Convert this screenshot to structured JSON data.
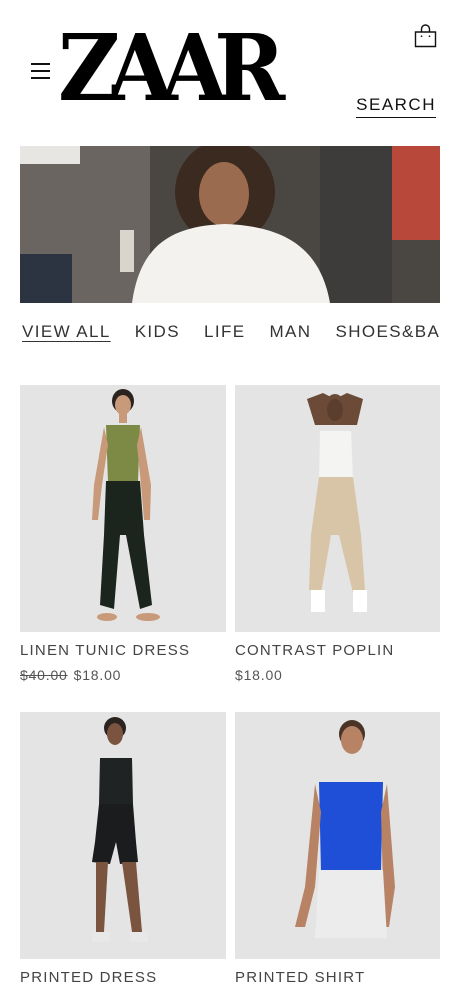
{
  "header": {
    "logo_text": "ZAAR",
    "search_label": "SEARCH",
    "menu_icon": "hamburger-menu-icon",
    "bag_icon": "shopping-bag-icon"
  },
  "hero": {
    "image": "woman-in-white-tee-photo"
  },
  "tabs": [
    {
      "label": "VIEW ALL",
      "active": true
    },
    {
      "label": "KIDS",
      "active": false
    },
    {
      "label": "LIFE",
      "active": false
    },
    {
      "label": "MAN",
      "active": false
    },
    {
      "label": "SHOES&BAGS",
      "active": false
    }
  ],
  "products": [
    {
      "name": "LINEN TUNIC DRESS",
      "old_price": "$40.00",
      "price": "$18.00",
      "image": "model-green-tank-black-leggings"
    },
    {
      "name": "CONTRAST POPLIN",
      "old_price": "",
      "price": "$18.00",
      "image": "model-white-top-beige-joggers"
    },
    {
      "name": "PRINTED DRESS",
      "old_price": "",
      "price": "",
      "image": "model-black-crop-bike-shorts"
    },
    {
      "name": "PRINTED SHIRT",
      "old_price": "",
      "price": "",
      "image": "model-blue-tank-white-shorts"
    }
  ],
  "colors": {
    "text": "#333333",
    "image_bg": "#e6e6e6",
    "logo": "#000000"
  }
}
